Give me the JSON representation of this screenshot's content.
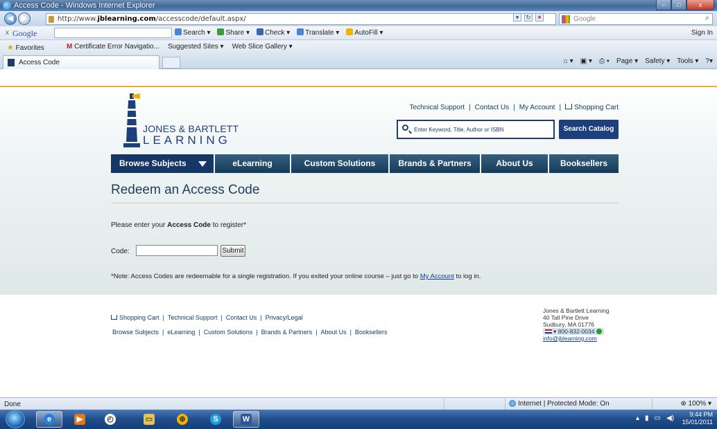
{
  "window": {
    "title": "Access Code - Windows Internet Explorer",
    "controls": [
      "–",
      "□",
      "x"
    ]
  },
  "address_bar": {
    "url_prefix": "http://www.",
    "url_domain": "jblearning.com",
    "url_path": "/accesscode/default.aspx/",
    "search_placeholder": "Google"
  },
  "google_toolbar": {
    "close": "x",
    "logo": "Google",
    "items": [
      "Search ▾",
      "Share ▾",
      "Check ▾",
      "Translate ▾",
      "AutoFill ▾"
    ],
    "sign_in": "Sign In"
  },
  "favorites_bar": {
    "favorites_label": "Favorites",
    "links": [
      "Certificate Error Navigatio...",
      "Suggested Sites ▾",
      "Web Slice Gallery ▾"
    ]
  },
  "tab": {
    "label": "Access Code"
  },
  "command_bar": [
    "Page ▾",
    "Safety ▾",
    "Tools ▾"
  ],
  "site": {
    "logo_line1": "JONES & BARTLETT",
    "logo_line2": "LEARNING",
    "top_links": [
      "Technical Support",
      "Contact Us",
      "My Account",
      "Shopping Cart"
    ],
    "search_placeholder": "Enter Keyword, Title, Author or ISBN",
    "search_button": "Search Catalog",
    "nav": [
      "Browse Subjects",
      "eLearning",
      "Custom Solutions",
      "Brands & Partners",
      "About Us",
      "Booksellers"
    ],
    "page_title": "Redeem an Access Code",
    "prompt_pre": "Please enter your ",
    "prompt_bold": "Access Code",
    "prompt_post": " to register*",
    "code_label": "Code:",
    "submit_label": "Submit",
    "note_pre": "*Note: Access Codes are redeemable for a single registration. If you exited your online course – just go to ",
    "note_link": "My Account",
    "note_post": " to log in."
  },
  "footer": {
    "links_row1": [
      "Shopping Cart",
      "Technical Support",
      "Contact Us",
      "Privacy/Legal"
    ],
    "links_row2": [
      "Browse Subjects",
      "eLearning",
      "Custom Solutions",
      "Brands & Partners",
      "About Us",
      "Booksellers"
    ],
    "address_name": "Jones & Bartlett Learning",
    "address_street": "40 Tall Pine Drive",
    "address_city": "Sudbury, MA 01776",
    "phone": "800-832-0034",
    "email": "info@jblearning.com"
  },
  "status_bar": {
    "status": "Done",
    "zone": "Internet | Protected Mode: On",
    "zoom": "100%"
  },
  "taskbar": {
    "time": "9:44 PM",
    "date": "15/01/2011"
  }
}
